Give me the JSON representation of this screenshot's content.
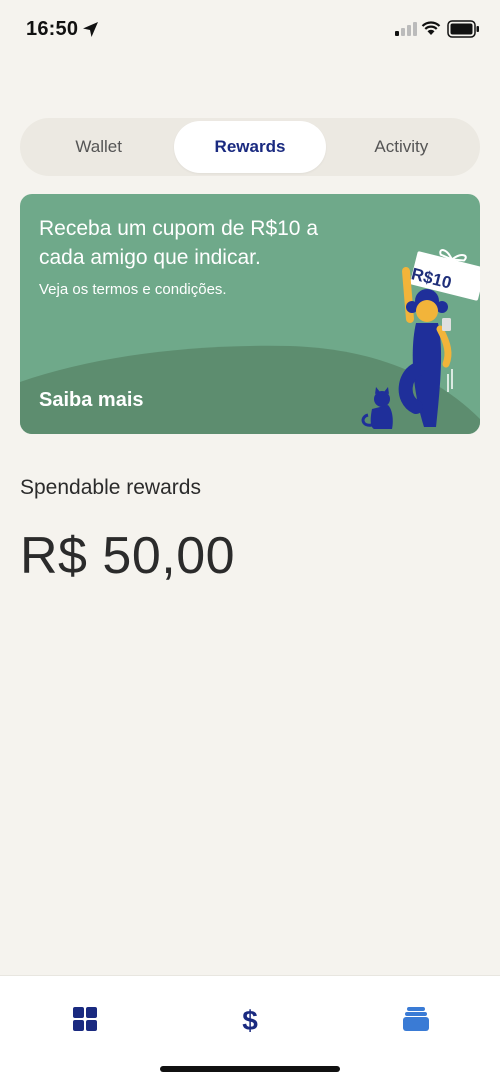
{
  "status_bar": {
    "time": "16:50"
  },
  "tabs": [
    {
      "label": "Wallet",
      "active": false
    },
    {
      "label": "Rewards",
      "active": true
    },
    {
      "label": "Activity",
      "active": false
    }
  ],
  "promo": {
    "title": "Receba um cupom de R$10 a cada amigo que indicar.",
    "terms": "Veja os termos e condições.",
    "cta": "Saiba mais",
    "coupon": "R$10"
  },
  "rewards": {
    "label": "Spendable rewards",
    "amount": "R$ 50,00"
  },
  "bottom_nav": {
    "items": [
      {
        "icon": "wallet-grid-icon"
      },
      {
        "icon": "dollar-icon"
      },
      {
        "icon": "activity-stack-icon"
      }
    ]
  },
  "colors": {
    "background": "#f5f3ee",
    "accent": "#1a2a80",
    "promo_green": "#6fa98a",
    "nav_blue": "#3a7bd5"
  }
}
